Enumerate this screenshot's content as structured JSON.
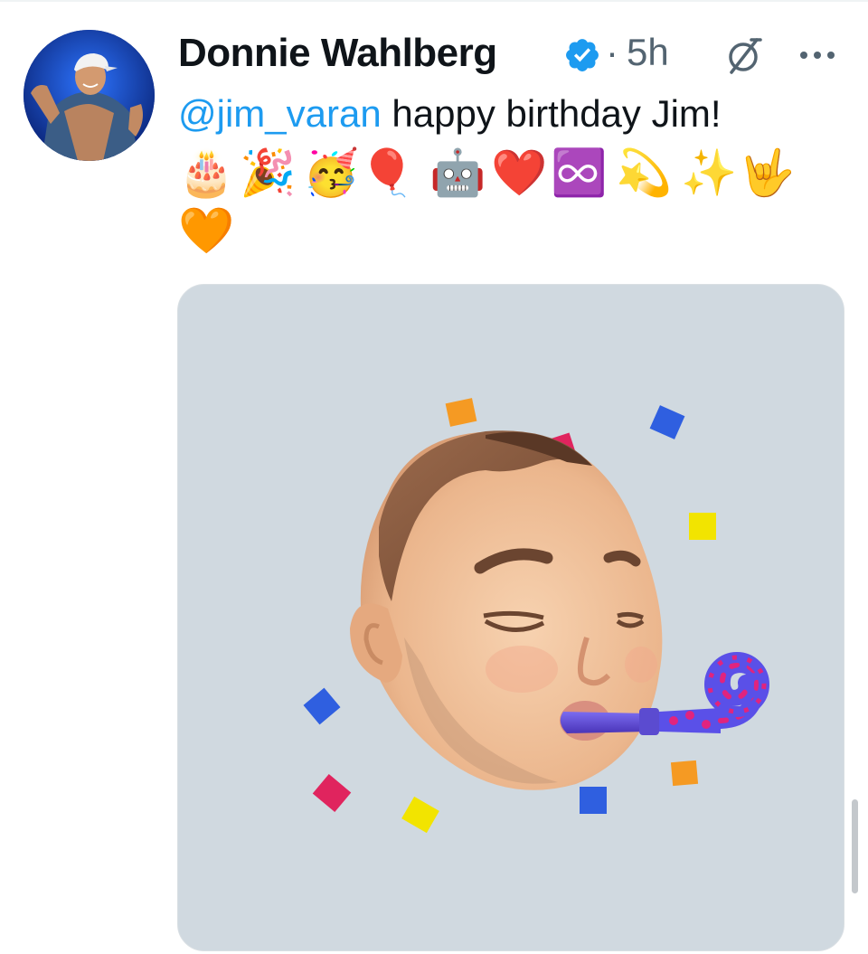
{
  "tweet": {
    "author": {
      "name": "Donnie Wahlberg",
      "verified": true,
      "avatar_icon": "avatar-photo"
    },
    "separator": "·",
    "timestamp": "5h",
    "text": {
      "mention": "@jim_varan",
      "body": " happy birthday Jim!"
    },
    "emojis_row1": [
      "🎂",
      "🎉",
      "🥳",
      "🎈",
      "🤖",
      "❤️",
      "♾️",
      "💫",
      "✨",
      "🤟"
    ],
    "emojis_row2": [
      "🧡"
    ],
    "media": {
      "type": "memoji-sticker",
      "description_icon": "memoji-party-blower-image"
    }
  },
  "icons": {
    "verified": "verified-badge-icon",
    "grok": "grok-icon",
    "more": "more-options-icon"
  },
  "colors": {
    "text": "#0f1419",
    "secondary": "#536471",
    "link": "#1d9bf0",
    "verified": "#1d9bf0",
    "media_bg": "#d0d9e0"
  }
}
